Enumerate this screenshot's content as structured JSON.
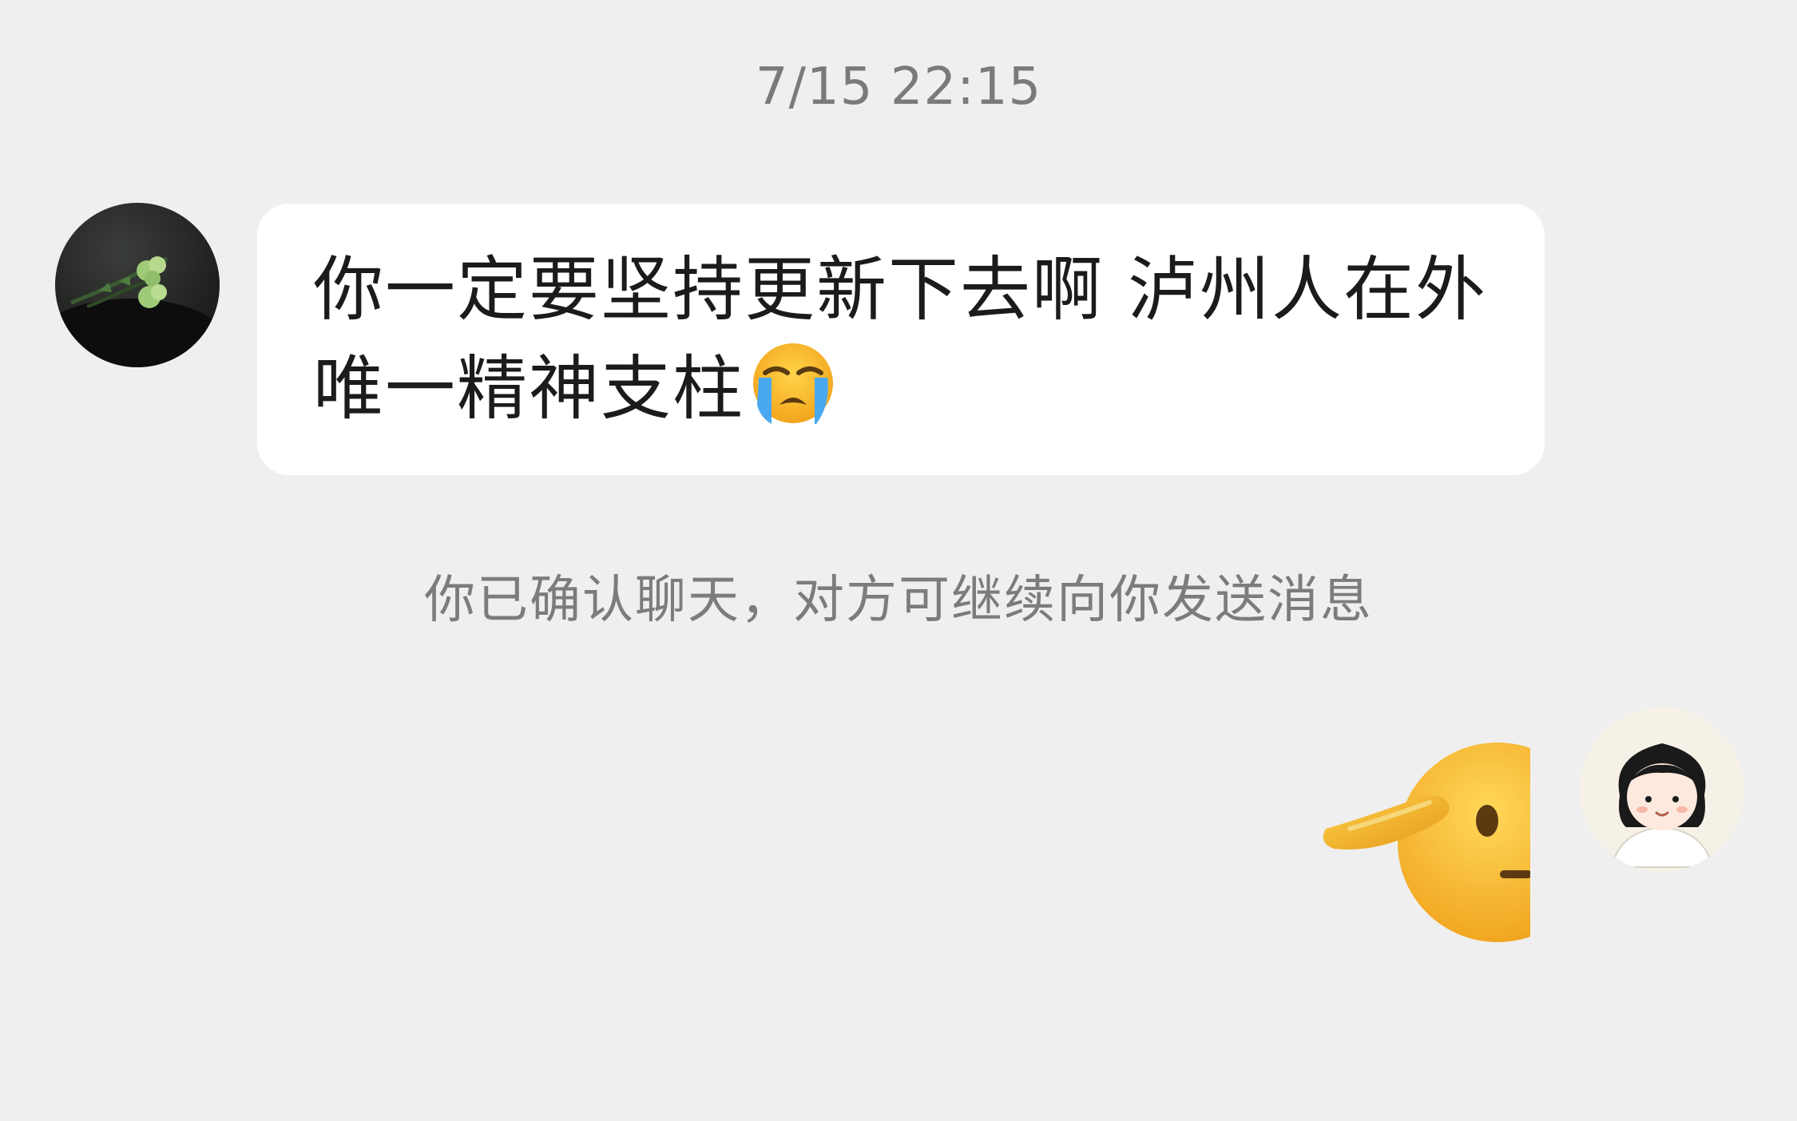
{
  "chat": {
    "timestamp": "7/15 22:15",
    "messages": [
      {
        "from": "other",
        "text": "你一定要坚持更新下去啊 泸州人在外唯一精神支柱",
        "emoji": "loudly-crying-face"
      },
      {
        "from": "me",
        "sticker": "saluting-face"
      }
    ],
    "notice": "你已确认聊天，对方可继续向你发送消息"
  }
}
